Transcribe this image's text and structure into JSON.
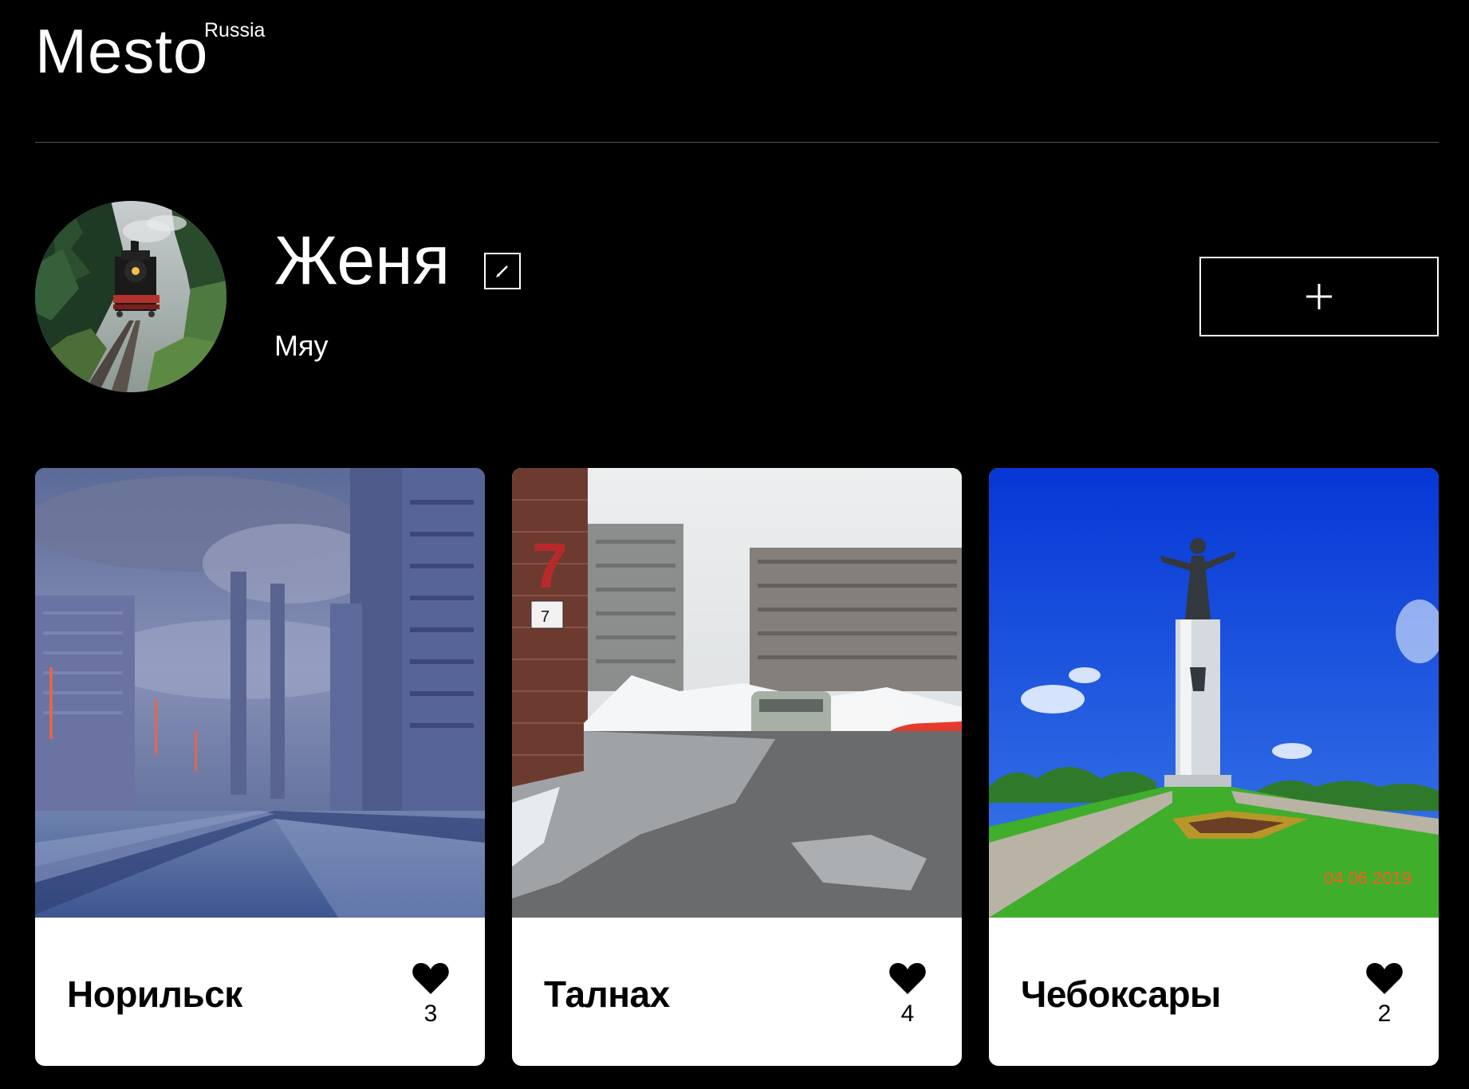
{
  "header": {
    "logo": "Mesto",
    "logo_sup": "Russia"
  },
  "profile": {
    "name": "Женя",
    "about": "Мяу",
    "avatar_icon": "avatar-train-photo",
    "edit_icon": "pencil-icon",
    "add_icon": "plus-icon"
  },
  "cards": [
    {
      "title": "Норильск",
      "likes": "3",
      "icon": "heart-icon"
    },
    {
      "title": "Талнах",
      "likes": "4",
      "icon": "heart-icon"
    },
    {
      "title": "Чебоксары",
      "likes": "2",
      "icon": "heart-icon",
      "photo_stamp": "04 06 2019"
    }
  ],
  "colors": {
    "background": "#000000",
    "card": "#ffffff",
    "divider": "#545454",
    "stamp": "#ff5a1f"
  }
}
